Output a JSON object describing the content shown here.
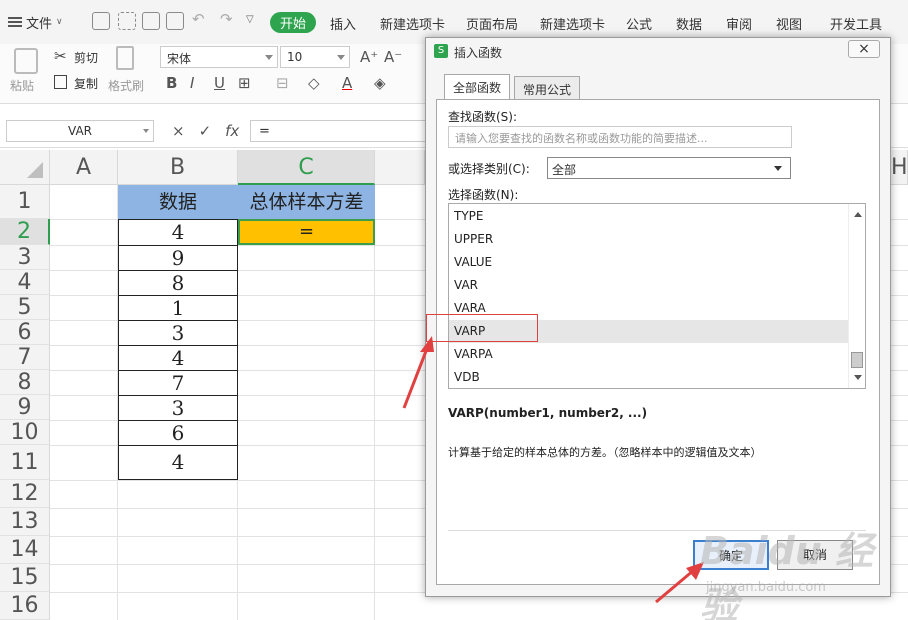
{
  "menubar": {
    "file_label": "文件",
    "tabs": [
      "开始",
      "插入",
      "新建选项卡",
      "页面布局",
      "新建选项卡",
      "公式",
      "数据",
      "审阅",
      "视图",
      "开发工具"
    ],
    "active_tab": "开始"
  },
  "ribbon": {
    "paste": "粘贴",
    "cut": "剪切",
    "copy": "复制",
    "format_painter": "格式刷",
    "font_name": "宋体",
    "font_size": "10"
  },
  "formula_bar": {
    "name_box": "VAR",
    "cancel": "×",
    "confirm": "✓",
    "fx": "fx",
    "formula": "="
  },
  "sheet": {
    "columns": [
      "A",
      "B",
      "C",
      "H"
    ],
    "rows": [
      "1",
      "2",
      "3",
      "4",
      "5",
      "6",
      "7",
      "8",
      "9",
      "10",
      "11",
      "12",
      "13",
      "14",
      "15",
      "16"
    ],
    "b1": "数据",
    "c1": "总体样本方差",
    "c2": "=",
    "values": [
      "4",
      "9",
      "8",
      "1",
      "3",
      "4",
      "7",
      "3",
      "6",
      "4"
    ]
  },
  "dialog": {
    "title": "插入函数",
    "close": "×",
    "tabs": [
      "全部函数",
      "常用公式"
    ],
    "search_label": "查找函数(S):",
    "search_placeholder": "请输入您要查找的函数名称或函数功能的简要描述...",
    "category_label": "或选择类别(C):",
    "category_value": "全部",
    "select_label": "选择函数(N):",
    "functions": [
      "TYPE",
      "UPPER",
      "VALUE",
      "VAR",
      "VARA",
      "VARP",
      "VARPA",
      "VDB"
    ],
    "selected_function": "VARP",
    "signature": "VARP(number1, number2, ...)",
    "description": "计算基于给定的样本总体的方差。（忽略样本中的逻辑值及文本）",
    "ok": "确定",
    "cancel": "取消"
  },
  "watermark": {
    "main": "Baidu 经验",
    "sub": "jingyan.baidu.com"
  },
  "colors": {
    "accent_green": "#2ea44f",
    "header_blue": "#8db4e2",
    "active_yellow": "#ffc000",
    "annotation_red": "#e04040"
  }
}
